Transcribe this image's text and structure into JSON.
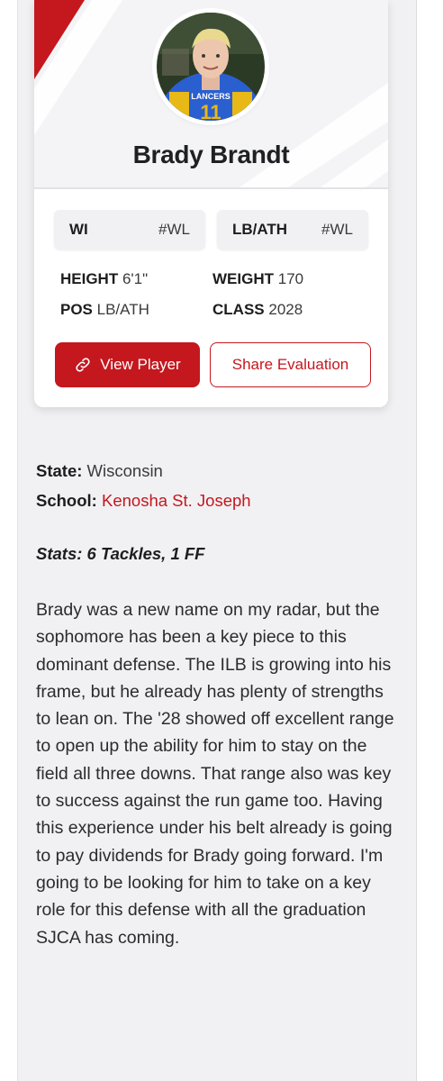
{
  "player": {
    "name": "Brady Brandt",
    "photo_jersey_text": "LANCERS",
    "photo_jersey_number": "11",
    "tags": [
      {
        "label": "WI",
        "rank": "#WL"
      },
      {
        "label": "LB/ATH",
        "rank": "#WL"
      }
    ],
    "attributes": {
      "height_label": "HEIGHT",
      "height_value": "6'1\"",
      "weight_label": "WEIGHT",
      "weight_value": "170",
      "pos_label": "POS",
      "pos_value": "LB/ATH",
      "class_label": "CLASS",
      "class_value": "2028"
    }
  },
  "buttons": {
    "view_player": "View Player",
    "share_evaluation": "Share Evaluation"
  },
  "details": {
    "state_label": "State:",
    "state_value": "Wisconsin",
    "school_label": "School:",
    "school_value": "Kenosha St. Joseph",
    "stats": "Stats: 6 Tackles, 1 FF"
  },
  "evaluation": "Brady was a new name on my radar, but the sophomore has been a key piece to this dominant defense. The ILB is growing into his frame, but he already has plenty of strengths to lean on. The '28 showed off excellent range to open up the ability for him to stay on the field all three downs. That range also was key to success against the run game too. Having this experience under his belt already is going to pay dividends for Brady going forward. I'm going to be looking for him to take on a key role for this defense with all the graduation SJCA has coming.",
  "colors": {
    "accent": "#c4171e",
    "page_bg": "#f1f1f3",
    "card_bg": "#ffffff",
    "jersey_blue": "#2a5fd0",
    "jersey_gold": "#e8b816"
  },
  "icons": {
    "view_player": "link-icon"
  }
}
